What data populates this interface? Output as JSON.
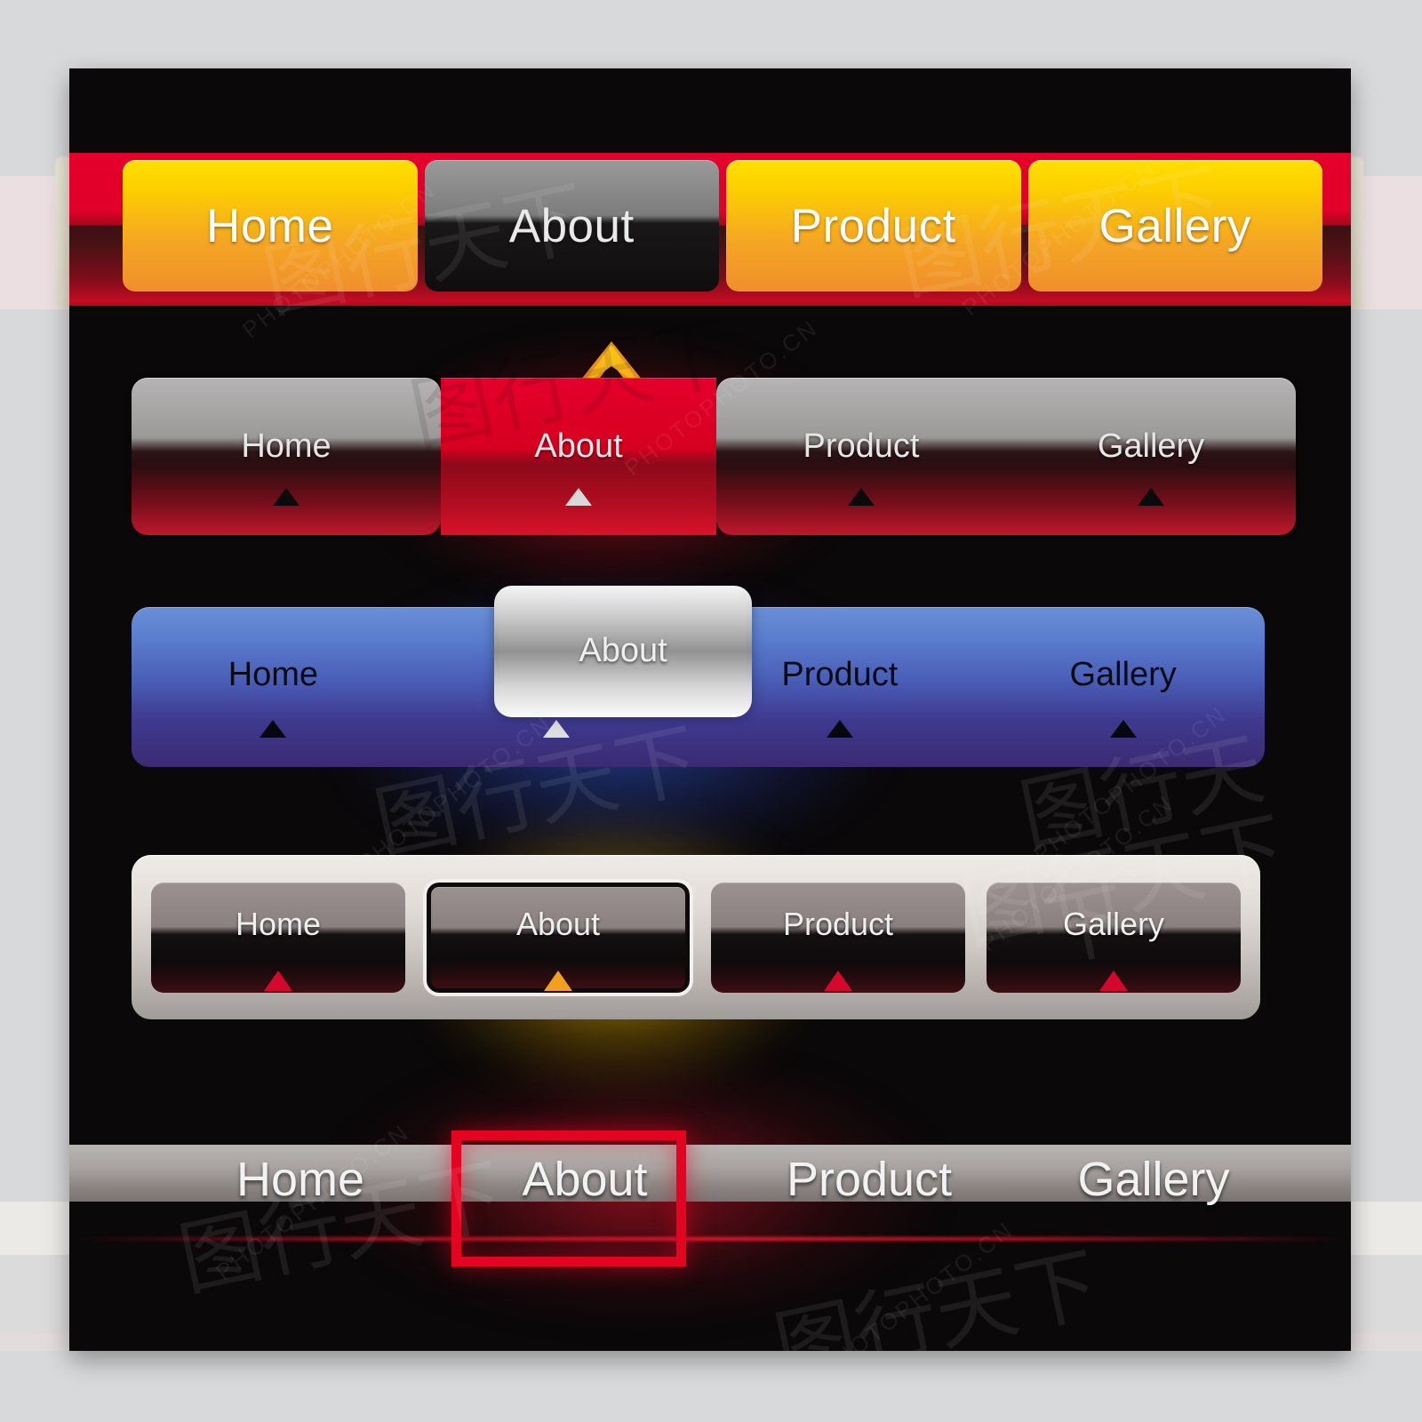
{
  "nav_items": [
    "Home",
    "About",
    "Product",
    "Gallery"
  ],
  "selected_item": "About",
  "bars": [
    {
      "id": "bar-yellow-tabs",
      "style_name": "yellow-tabs-on-red-strip",
      "items": [
        {
          "label": "Home",
          "state": "normal",
          "arrow": "none"
        },
        {
          "label": "About",
          "state": "selected",
          "arrow": "chevron-up-orange"
        },
        {
          "label": "Product",
          "state": "normal",
          "arrow": "none"
        },
        {
          "label": "Gallery",
          "state": "normal",
          "arrow": "none"
        }
      ],
      "colors": {
        "strip": "#e4002b",
        "tab": "#fccf00",
        "tab_active": "#7c7c7c",
        "arrow": "#f5a623"
      }
    },
    {
      "id": "bar-red-glossy",
      "style_name": "silver-and-red-glossy",
      "items": [
        {
          "label": "Home",
          "state": "normal",
          "arrow": "triangle-up-black"
        },
        {
          "label": "About",
          "state": "selected",
          "arrow": "triangle-up-white"
        },
        {
          "label": "Product",
          "state": "normal",
          "arrow": "triangle-up-black"
        },
        {
          "label": "Gallery",
          "state": "normal",
          "arrow": "triangle-up-black"
        }
      ],
      "colors": {
        "silver": "#b6b4b4",
        "red": "#e4002b",
        "glow": "#ff1428"
      }
    },
    {
      "id": "bar-blue-purple",
      "style_name": "blue-to-purple-gradient",
      "items": [
        {
          "label": "Home",
          "state": "normal",
          "arrow": "triangle-up-black"
        },
        {
          "label": "About",
          "state": "selected",
          "arrow": "triangle-up-white"
        },
        {
          "label": "Product",
          "state": "normal",
          "arrow": "triangle-up-black"
        },
        {
          "label": "Gallery",
          "state": "normal",
          "arrow": "triangle-up-black"
        }
      ],
      "colors": {
        "top": "#6a8fd6",
        "bottom": "#3c2a72",
        "selection_outline": "#d8d8d8",
        "glow": "#3c6eff"
      }
    },
    {
      "id": "bar-silver-shell",
      "style_name": "silver-shell-dark-keys",
      "items": [
        {
          "label": "Home",
          "state": "normal",
          "arrow": "triangle-up-red"
        },
        {
          "label": "About",
          "state": "selected",
          "arrow": "triangle-up-orange"
        },
        {
          "label": "Product",
          "state": "normal",
          "arrow": "triangle-up-red"
        },
        {
          "label": "Gallery",
          "state": "normal",
          "arrow": "triangle-up-red"
        }
      ],
      "colors": {
        "shell": "#e3ded9",
        "key": "#0d0a0b",
        "arrow": "#d4072c",
        "arrow_active": "#f0a01c",
        "glow": "#ffcd00"
      }
    },
    {
      "id": "bar-gray-strip",
      "style_name": "full-width-gray-strip",
      "items": [
        {
          "label": "Home",
          "state": "normal",
          "arrow": "none"
        },
        {
          "label": "About",
          "state": "selected",
          "arrow": "none"
        },
        {
          "label": "Product",
          "state": "normal",
          "arrow": "none"
        },
        {
          "label": "Gallery",
          "state": "normal",
          "arrow": "none"
        }
      ],
      "colors": {
        "strip": "#a8a3a1",
        "selection_box": "#e30422",
        "redline": "#e3192d",
        "glow": "#eb142d"
      }
    }
  ],
  "watermark": {
    "text": "PHOTOPHOTO.CN",
    "glyph": "图行天下"
  }
}
